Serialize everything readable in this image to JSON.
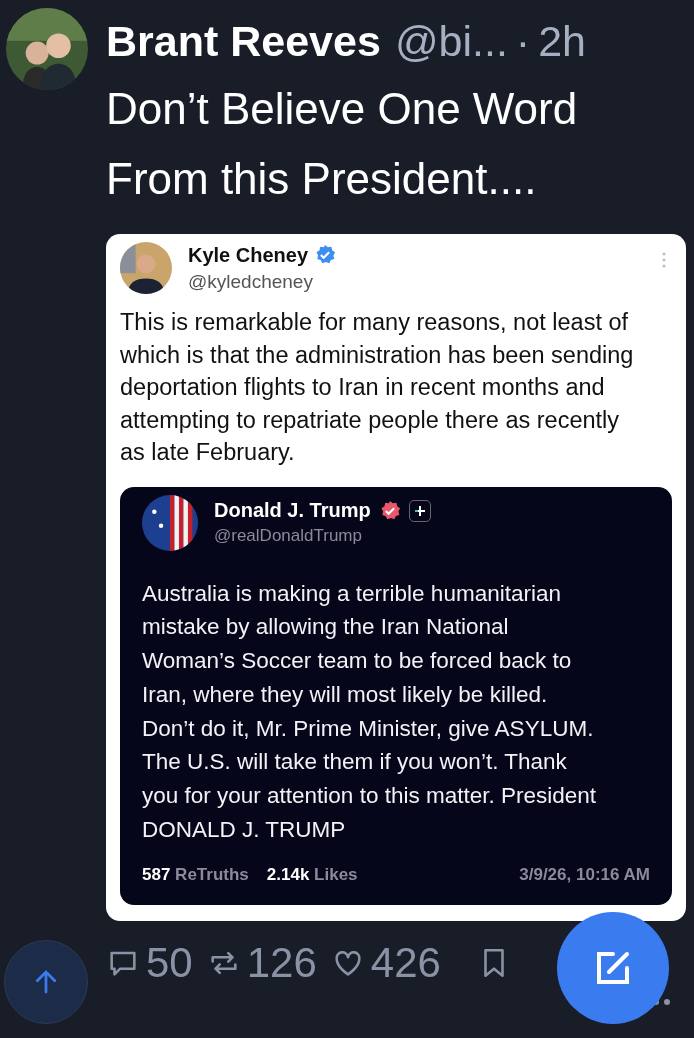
{
  "post": {
    "author": "Brant Reeves",
    "handle": "@bi...",
    "separator": "·",
    "time": "2h",
    "text": "Don’t Believe One Word From this President....",
    "quote": {
      "author": "Kyle Cheney",
      "verified": true,
      "handle": "@kyledcheney",
      "text": "This is remarkable for many reasons, not least of which is that the administration has been sending deportation flights to Iran in recent months and attempting to repatriate people there as recently as late February.",
      "embed": {
        "author": "Donald J. Trump",
        "verified": true,
        "handle": "@realDonaldTrump",
        "text": "Australia is making a terrible humanitarian mistake by allowing the Iran National Woman’s Soccer team to be forced back to Iran, where they will most likely be killed. Don’t do it, Mr. Prime Minister, give ASYLUM. The U.S. will take them if you won’t. Thank you for your attention to this matter. President DONALD J. TRUMP",
        "stats": [
          {
            "count": "587",
            "label": "ReTruths"
          },
          {
            "count": "2.14k",
            "label": "Likes"
          }
        ],
        "date": "3/9/26, 10:16 AM"
      }
    },
    "actions": [
      {
        "kind": "reply",
        "count": "50"
      },
      {
        "kind": "repost",
        "count": "126"
      },
      {
        "kind": "like",
        "count": "426"
      },
      {
        "kind": "bookmark"
      }
    ]
  }
}
